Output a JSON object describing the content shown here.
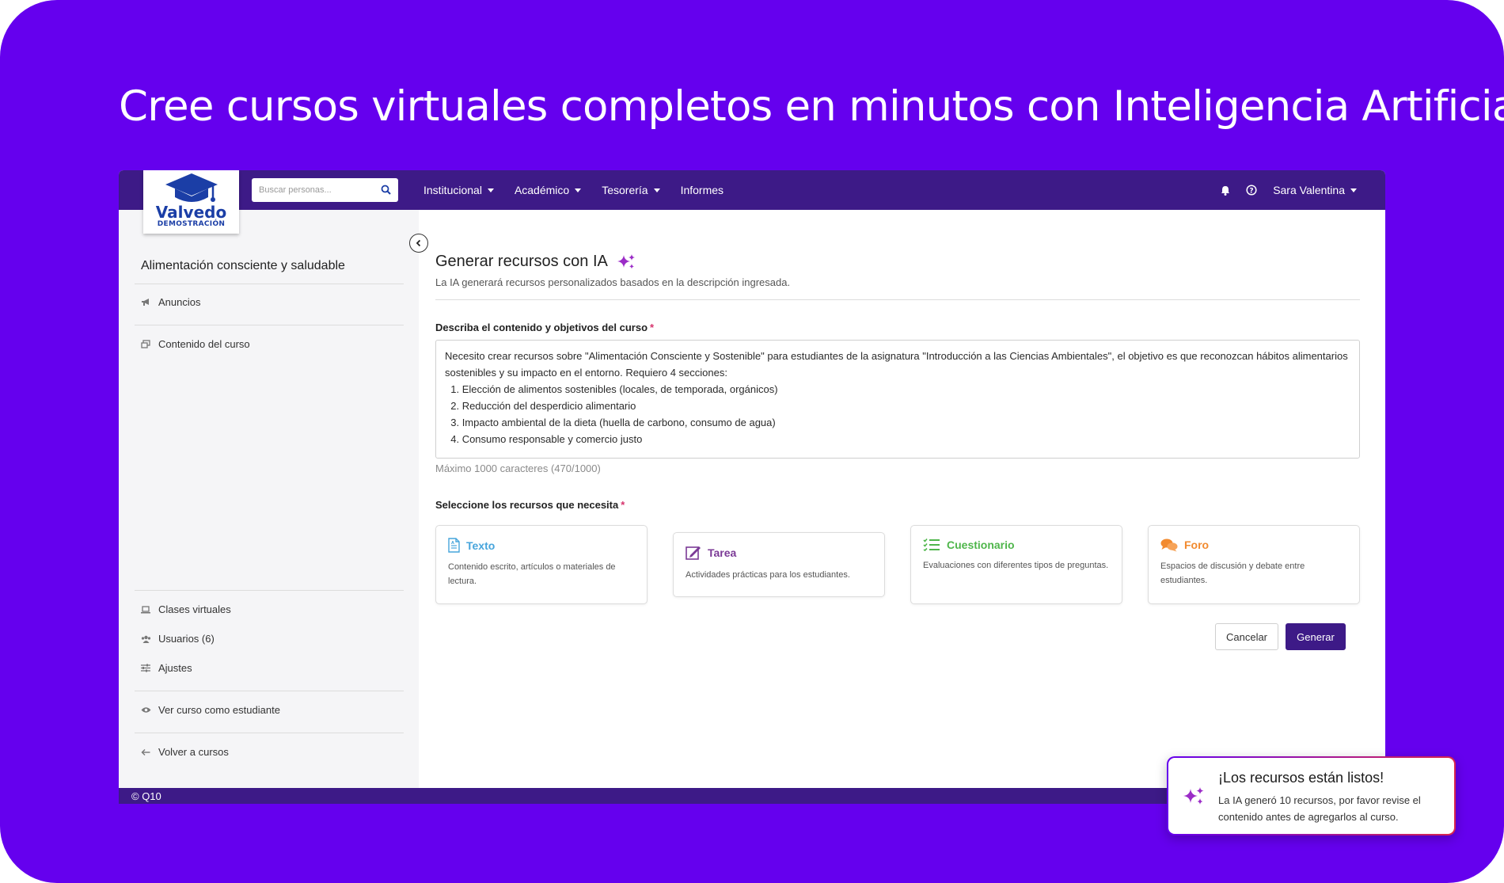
{
  "banner": {
    "headline": "Cree cursos virtuales completos en minutos con Inteligencia Artificial"
  },
  "colors": {
    "background": "#6500ee",
    "navbar": "#3d1a87",
    "primary_button": "#3d1a87",
    "texto": "#47a5dc",
    "tarea": "#7b3a96",
    "cuestionario": "#4fb64b",
    "foro": "#f28a2e",
    "required": "#d6336c"
  },
  "logo": {
    "name": "Valvedo",
    "subtitle": "DEMOSTRACIÓN"
  },
  "navbar": {
    "search_placeholder": "Buscar personas...",
    "menu": [
      {
        "label": "Institucional",
        "has_dropdown": true
      },
      {
        "label": "Académico",
        "has_dropdown": true
      },
      {
        "label": "Tesorería",
        "has_dropdown": true
      },
      {
        "label": "Informes",
        "has_dropdown": false
      }
    ],
    "user_name": "Sara Valentina",
    "icons": [
      "bell-icon",
      "help-icon"
    ]
  },
  "sidebar": {
    "course_title": "Alimentación consciente y saludable",
    "items": [
      {
        "label": "Anuncios",
        "icon": "megaphone-icon"
      },
      {
        "label": "Contenido del curso",
        "icon": "content-icon"
      },
      {
        "label": "Clases virtuales",
        "icon": "laptop-icon"
      },
      {
        "label": "Usuarios (6)",
        "icon": "users-icon"
      },
      {
        "label": "Ajustes",
        "icon": "sliders-icon"
      },
      {
        "label": "Ver curso como estudiante",
        "icon": "eye-icon"
      },
      {
        "label": "Volver a cursos",
        "icon": "arrow-left-icon"
      }
    ]
  },
  "main": {
    "title": "Generar recursos con IA",
    "subtitle": "La IA generará recursos personalizados basados en la descripción ingresada.",
    "description_label": "Describa el contenido y objetivos del curso",
    "description_value": "Necesito crear recursos sobre \"Alimentación Consciente y Sostenible\" para estudiantes de la asignatura \"Introducción a las Ciencias Ambientales\", el objetivo es que reconozcan hábitos alimentarios sostenibles y su impacto en el entorno. Requiero 4 secciones:\n  1. Elección de alimentos sostenibles (locales, de temporada, orgánicos)\n  2. Reducción del desperdicio alimentario\n  3. Impacto ambiental de la dieta (huella de carbono, consumo de agua)\n  4. Consumo responsable y comercio justo",
    "counter": "Máximo 1000 caracteres (470/1000)",
    "resources_label": "Seleccione los recursos que necesita",
    "resources": [
      {
        "name": "Texto",
        "description": "Contenido escrito, artículos o materiales de lectura.",
        "icon": "document-icon"
      },
      {
        "name": "Tarea",
        "description": "Actividades prácticas para los estudiantes.",
        "icon": "edit-icon"
      },
      {
        "name": "Cuestionario",
        "description": "Evaluaciones con diferentes tipos de preguntas.",
        "icon": "checklist-icon"
      },
      {
        "name": "Foro",
        "description": "Espacios de discusión y debate entre estudiantes.",
        "icon": "chat-icon"
      }
    ],
    "cancel_label": "Cancelar",
    "generate_label": "Generar"
  },
  "footer": {
    "copyright": "© Q10"
  },
  "toast": {
    "title": "¡Los recursos están listos!",
    "body": "La IA generó 10 recursos, por favor revise el contenido antes de agregarlos al curso."
  }
}
